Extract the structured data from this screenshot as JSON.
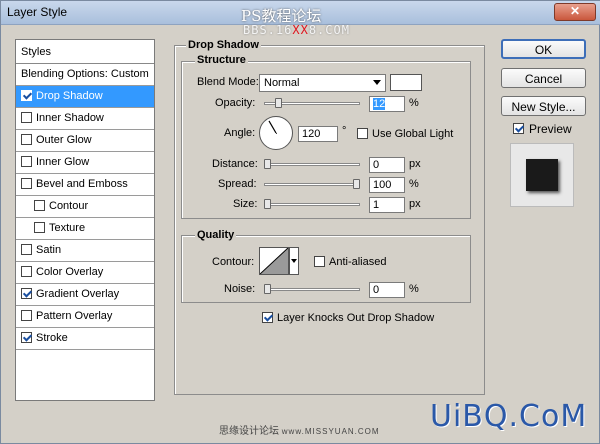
{
  "window": {
    "title": "Layer Style",
    "close_glyph": "✕",
    "watermark_top": "PS教程论坛",
    "watermark_url_a": "BBS.16",
    "watermark_url_b": "XX",
    "watermark_url_c": "8.COM"
  },
  "styles_panel": {
    "header": "Styles",
    "items": [
      {
        "label": "Blending Options: Custom",
        "checkbox": false,
        "checked": false,
        "selected": false,
        "sub": false
      },
      {
        "label": "Drop Shadow",
        "checkbox": true,
        "checked": true,
        "selected": true,
        "sub": false
      },
      {
        "label": "Inner Shadow",
        "checkbox": true,
        "checked": false,
        "selected": false,
        "sub": false
      },
      {
        "label": "Outer Glow",
        "checkbox": true,
        "checked": false,
        "selected": false,
        "sub": false
      },
      {
        "label": "Inner Glow",
        "checkbox": true,
        "checked": false,
        "selected": false,
        "sub": false
      },
      {
        "label": "Bevel and Emboss",
        "checkbox": true,
        "checked": false,
        "selected": false,
        "sub": false
      },
      {
        "label": "Contour",
        "checkbox": true,
        "checked": false,
        "selected": false,
        "sub": true
      },
      {
        "label": "Texture",
        "checkbox": true,
        "checked": false,
        "selected": false,
        "sub": true
      },
      {
        "label": "Satin",
        "checkbox": true,
        "checked": false,
        "selected": false,
        "sub": false
      },
      {
        "label": "Color Overlay",
        "checkbox": true,
        "checked": false,
        "selected": false,
        "sub": false
      },
      {
        "label": "Gradient Overlay",
        "checkbox": true,
        "checked": true,
        "selected": false,
        "sub": false
      },
      {
        "label": "Pattern Overlay",
        "checkbox": true,
        "checked": false,
        "selected": false,
        "sub": false
      },
      {
        "label": "Stroke",
        "checkbox": true,
        "checked": true,
        "selected": false,
        "sub": false
      }
    ]
  },
  "drop_shadow": {
    "title": "Drop Shadow",
    "structure": {
      "title": "Structure",
      "blend_mode_label": "Blend Mode:",
      "blend_mode_value": "Normal",
      "shadow_color": "#ffffff",
      "opacity_label": "Opacity:",
      "opacity_value": "12",
      "opacity_unit": "%",
      "opacity_level": 12,
      "angle_label": "Angle:",
      "angle_value": "120",
      "angle_unit": "°",
      "angle_degrees": 120,
      "global_light_label": "Use Global Light",
      "global_light_checked": false,
      "distance_label": "Distance:",
      "distance_value": "0",
      "distance_unit": "px",
      "distance_level": 0,
      "spread_label": "Spread:",
      "spread_value": "100",
      "spread_unit": "%",
      "spread_level": 100,
      "size_label": "Size:",
      "size_value": "1",
      "size_unit": "px",
      "size_level": 0
    },
    "quality": {
      "title": "Quality",
      "contour_label": "Contour:",
      "anti_aliased_label": "Anti-aliased",
      "anti_aliased_checked": false,
      "noise_label": "Noise:",
      "noise_value": "0",
      "noise_unit": "%",
      "noise_level": 0
    },
    "knockout_label": "Layer Knocks Out Drop Shadow",
    "knockout_checked": true
  },
  "buttons": {
    "ok": "OK",
    "cancel": "Cancel",
    "new_style": "New Style...",
    "preview_label": "Preview",
    "preview_checked": true
  },
  "footer": {
    "watermark_cn": "思缘设计论坛",
    "watermark_url": "www.MISSYUAN.COM",
    "logo": "UiBQ.CoM"
  }
}
